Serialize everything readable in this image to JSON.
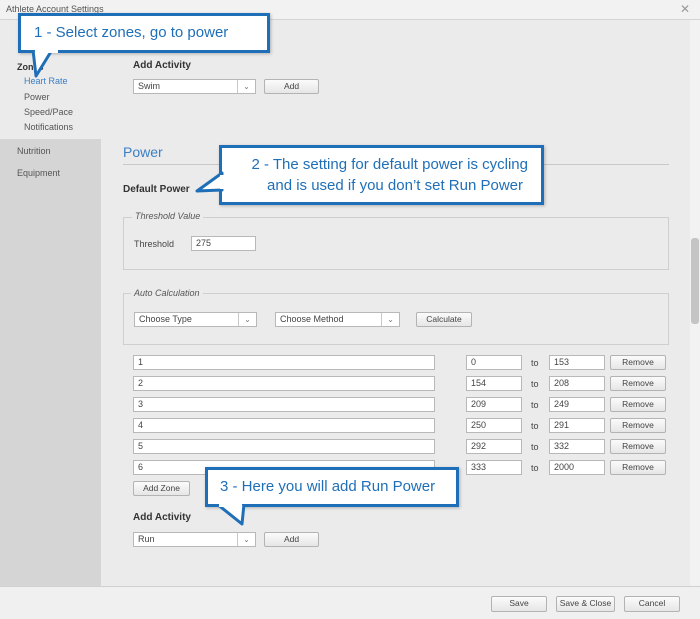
{
  "window": {
    "title": "Athlete Account Settings",
    "close": "✕"
  },
  "sidebar": {
    "section_label": "Zones",
    "sub_items": [
      "Heart Rate",
      "Power",
      "Speed/Pace",
      "Notifications"
    ],
    "items": [
      "Nutrition",
      "Equipment"
    ]
  },
  "top_add_activity": {
    "label": "Add Activity",
    "select_value": "Swim",
    "add_label": "Add"
  },
  "power": {
    "heading": "Power",
    "default_label": "Default Power",
    "threshold_legend": "Threshold Value",
    "threshold_label": "Threshold",
    "threshold_value": "275",
    "auto_legend": "Auto Calculation",
    "type_select": "Choose Type",
    "method_select": "Choose Method",
    "calculate_label": "Calculate",
    "to_label": "to",
    "remove_label": "Remove",
    "zones": [
      {
        "name": "1",
        "from": "0",
        "to": "153"
      },
      {
        "name": "2",
        "from": "154",
        "to": "208"
      },
      {
        "name": "3",
        "from": "209",
        "to": "249"
      },
      {
        "name": "4",
        "from": "250",
        "to": "291"
      },
      {
        "name": "5",
        "from": "292",
        "to": "332"
      },
      {
        "name": "6",
        "from": "333",
        "to": "2000"
      }
    ],
    "add_zone_label": "Add Zone"
  },
  "bottom_add_activity": {
    "label": "Add Activity",
    "select_value": "Run",
    "add_label": "Add"
  },
  "footer": {
    "save": "Save",
    "save_close": "Save & Close",
    "cancel": "Cancel"
  },
  "callouts": {
    "c1": "1 - Select zones, go to power",
    "c2_line1": "2 - The setting for default power is cycling",
    "c2_line2": "and is used if you don’t set Run Power",
    "c3": "3 - Here you will add Run Power"
  },
  "colors": {
    "accent": "#3b7fc4",
    "callout": "#1f6fb8"
  }
}
